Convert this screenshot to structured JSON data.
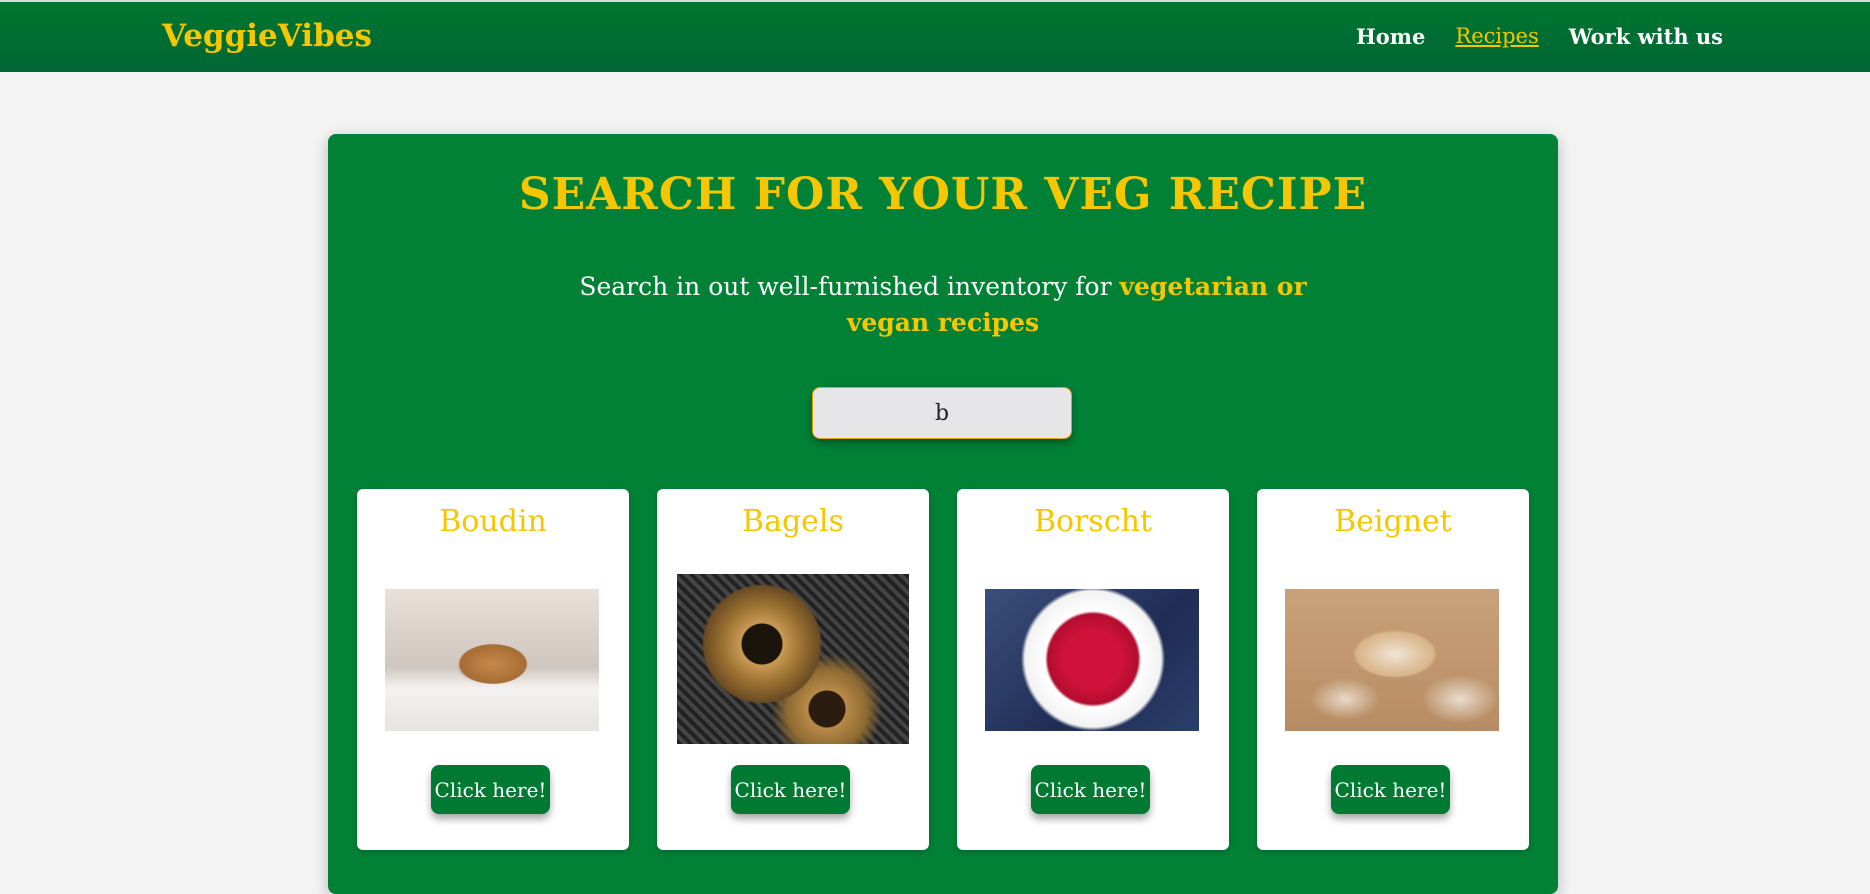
{
  "header": {
    "brand": "VeggieVibes",
    "nav": {
      "home": "Home",
      "recipes": "Recipes",
      "work": "Work with us"
    }
  },
  "panel": {
    "title": "SEARCH FOR YOUR VEG RECIPE",
    "subtitle_prefix": "Search in out well-furnished inventory for ",
    "subtitle_highlight": "vegetarian or vegan recipes",
    "search_value": "b"
  },
  "cards": [
    {
      "title": "Boudin",
      "button": "Click here!"
    },
    {
      "title": "Bagels",
      "button": "Click here!"
    },
    {
      "title": "Borscht",
      "button": "Click here!"
    },
    {
      "title": "Beignet",
      "button": "Click here!"
    }
  ],
  "colors": {
    "primary_green": "#008136",
    "header_green": "#006634",
    "accent_yellow": "#f6c700",
    "background": "#f3f3f3"
  }
}
